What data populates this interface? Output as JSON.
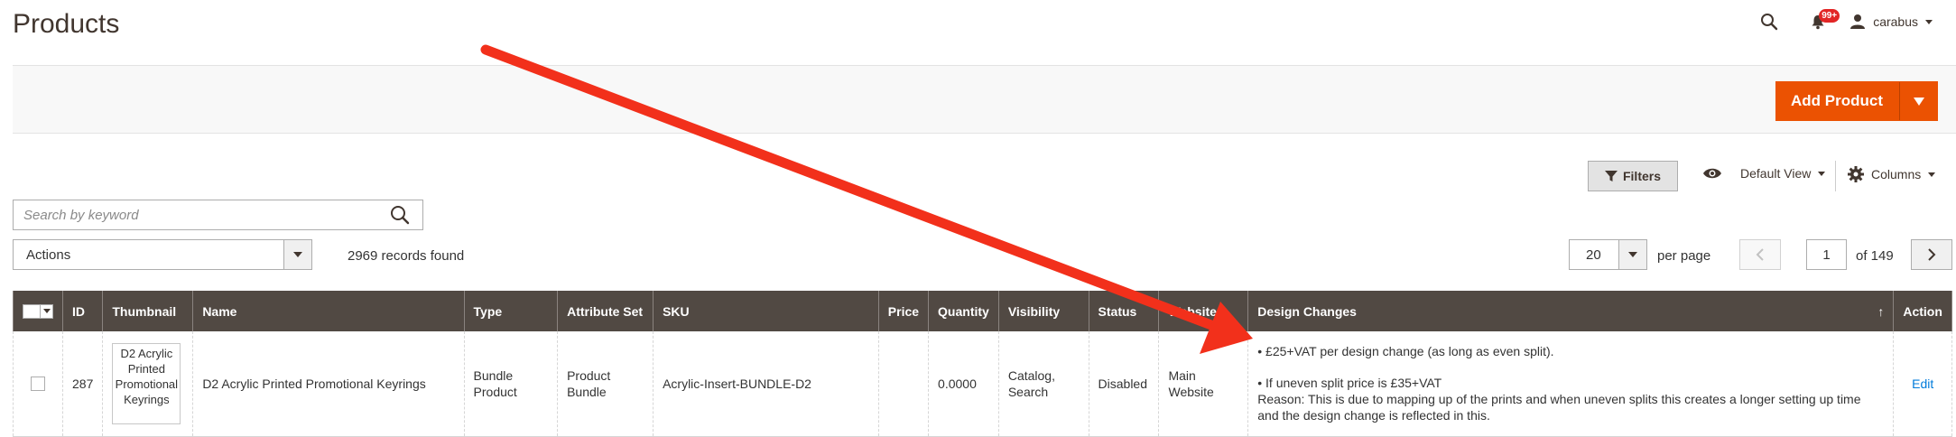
{
  "page": {
    "title": "Products"
  },
  "header": {
    "notifications_badge": "99+",
    "user_name": "carabus"
  },
  "toolbar": {
    "add_product_label": "Add Product"
  },
  "grid_controls": {
    "filters_label": "Filters",
    "view_label": "Default View",
    "columns_label": "Columns",
    "search_placeholder": "Search by keyword",
    "actions_label": "Actions",
    "records_found": "2969 records found",
    "per_page_value": "20",
    "per_page_label": "per page",
    "current_page": "1",
    "total_pages_label": "of 149"
  },
  "table": {
    "columns": [
      "ID",
      "Thumbnail",
      "Name",
      "Type",
      "Attribute Set",
      "SKU",
      "Price",
      "Quantity",
      "Visibility",
      "Status",
      "Websites",
      "Design Changes",
      "Action"
    ],
    "sort_indicator": "↑",
    "rows": [
      {
        "id": "287",
        "thumbnail_alt": "D2 Acrylic Printed Promotional Keyrings",
        "name": "D2 Acrylic Printed Promotional Keyrings",
        "type": "Bundle Product",
        "attribute_set": "Product Bundle",
        "sku": "Acrylic-Insert-BUNDLE-D2",
        "price": "",
        "quantity": "0.0000",
        "visibility": "Catalog, Search",
        "status": "Disabled",
        "websites": "Main Website",
        "design_changes": {
          "line1": "• £25+VAT per design change (as long as even split).",
          "line2": "• If uneven split price is £35+VAT",
          "line3": "Reason: This is due to mapping up of the prints and when uneven splits this creates a longer setting up time and the design change is reflected in this."
        },
        "action": "Edit"
      }
    ]
  },
  "colors": {
    "accent": "#eb5202",
    "header_bg": "#514943",
    "link": "#007bdb",
    "annotation_arrow": "#f2301b"
  }
}
